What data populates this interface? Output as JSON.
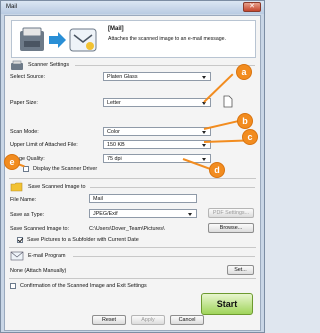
{
  "window": {
    "title": "Mail",
    "close_label": "✕"
  },
  "header": {
    "title": "[Mail]",
    "description": "Attaches the scanned image to an e-mail message."
  },
  "scanner": {
    "section_label": "Scanner Settings",
    "select_source": {
      "label": "Select Source:",
      "value": "Platen Glass"
    },
    "paper_size": {
      "label": "Paper Size:",
      "value": "Letter"
    },
    "scan_mode": {
      "label": "Scan Mode:",
      "value": "Color"
    },
    "upper_limit": {
      "label": "Upper Limit of Attached File:",
      "value": "150 KB"
    },
    "image_quality": {
      "label": "Image Quality:",
      "value": "75 dpi"
    },
    "display_driver": {
      "label": "Display the Scanner Driver",
      "checked": false
    }
  },
  "save": {
    "section_label": "Save Scanned Image to",
    "file_name": {
      "label": "File Name:",
      "value": "Mail"
    },
    "save_as_type": {
      "label": "Save as Type:",
      "value": "JPEG/Exif"
    },
    "pdf_settings_label": "PDF Settings...",
    "save_to": {
      "label": "Save Scanned Image to:",
      "value": "C:\\Users\\Dover_Team\\Pictures\\"
    },
    "browse_label": "Browse...",
    "subfolder": {
      "label": "Save Pictures to a Subfolder with Current Date",
      "checked": true
    }
  },
  "email": {
    "section_label": "E-mail Program",
    "program_value": "None (Attach Manually)",
    "set_label": "Set..."
  },
  "confirm": {
    "label": "Confirmation of the Scanned Image and Exit Settings",
    "checked": false
  },
  "footer": {
    "reset_label": "Reset",
    "apply_label": "Apply",
    "cancel_label": "Cancel",
    "start_label": "Start"
  },
  "callouts": [
    "a",
    "b",
    "c",
    "d",
    "e"
  ],
  "colors": {
    "callout": "#f28c1f",
    "start": "#9fd45a"
  }
}
